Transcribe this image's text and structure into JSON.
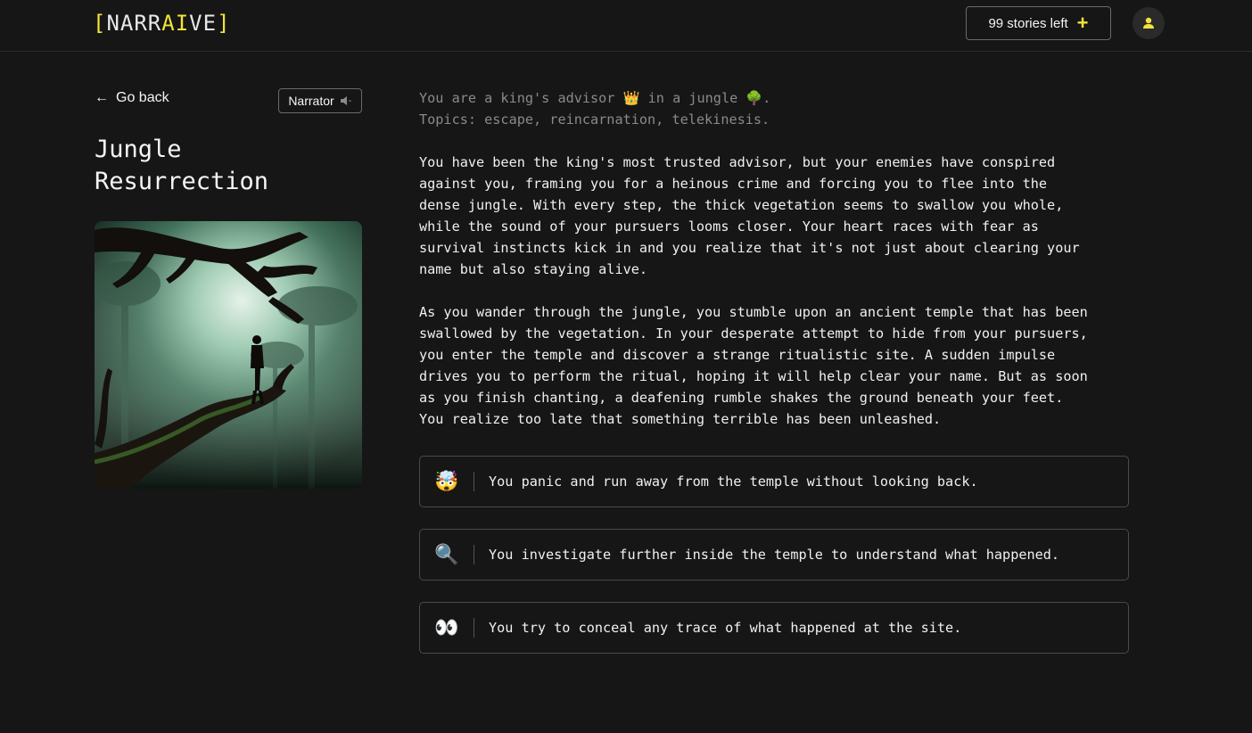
{
  "header": {
    "logo_open": "[",
    "logo_text_a": "NARR",
    "logo_text_b": "AI",
    "logo_text_c": "VE",
    "logo_close": "]",
    "stories_left_label": "99 stories left",
    "stories_plus": "+",
    "accent_color": "#f1e33a"
  },
  "sidebar": {
    "back_arrow": "←",
    "back_label": "Go back",
    "narrator_label": "Narrator",
    "narrator_icon": "speaker-muted-icon",
    "title": "Jungle Resurrection"
  },
  "story": {
    "meta_line1": "You are a king's advisor 👑 in a jungle 🌳.",
    "meta_line2": "Topics: escape, reincarnation, telekinesis.",
    "paragraph1": "You have been the king's most trusted advisor, but your enemies have conspired\nagainst you, framing you for a heinous crime and forcing you to flee into the\ndense jungle. With every step, the thick vegetation seems to swallow you whole,\nwhile the sound of your pursuers looms closer. Your heart races with fear as\nsurvival instincts kick in and you realize that it's not just about clearing your\nname but also staying alive.",
    "paragraph2": "As you wander through the jungle, you stumble upon an ancient temple that has been\nswallowed by the vegetation. In your desperate attempt to hide from your pursuers,\nyou enter the temple and discover a strange ritualistic site. A sudden impulse\ndrives you to perform the ritual, hoping it will help clear your name. But as soon\nas you finish chanting, a deafening rumble shakes the ground beneath your feet.\nYou realize too late that something terrible has been unleashed."
  },
  "choices": [
    {
      "emoji": "🤯",
      "text": "You panic and run away from the temple without looking back."
    },
    {
      "emoji": "🔍",
      "text": "You investigate further inside the temple to understand what happened."
    },
    {
      "emoji": "👀",
      "text": "You try to conceal any trace of what happened at the site."
    }
  ]
}
